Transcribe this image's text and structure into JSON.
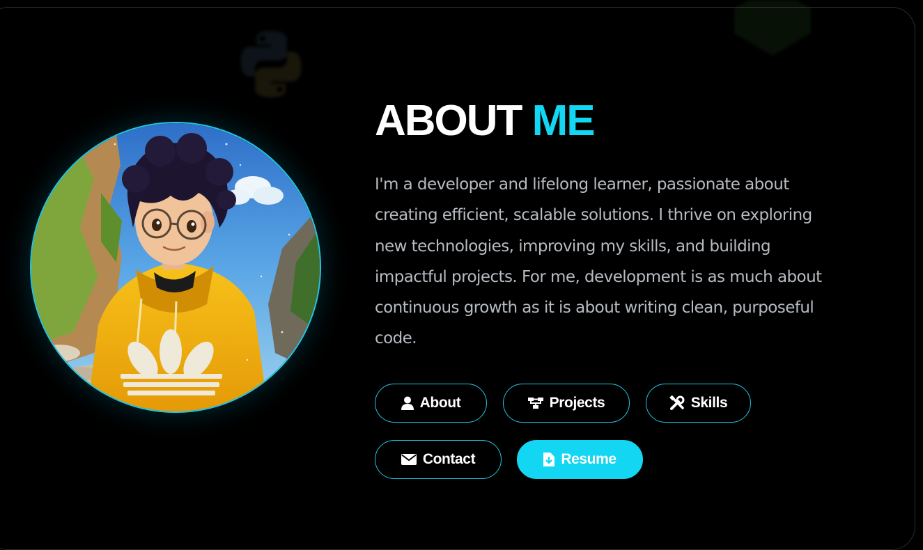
{
  "about": {
    "title_main": "ABOUT",
    "title_accent": "ME",
    "description": "I'm a developer and lifelong learner, passionate about creating efficient, scalable solutions. I thrive on exploring new technologies, improving my skills, and building impactful projects. For me, development is as much about continuous growth as it is about writing clean, purposeful code."
  },
  "buttons": {
    "about": {
      "label": "About",
      "icon": "user-icon"
    },
    "projects": {
      "label": "Projects",
      "icon": "sitemap-icon"
    },
    "skills": {
      "label": "Skills",
      "icon": "tools-icon"
    },
    "contact": {
      "label": "Contact",
      "icon": "envelope-icon"
    },
    "resume": {
      "label": "Resume",
      "icon": "file-download-icon"
    }
  },
  "colors": {
    "accent": "#12d6f2",
    "background": "#000000",
    "text": "#ffffff",
    "body_text": "#b7bcc2"
  }
}
